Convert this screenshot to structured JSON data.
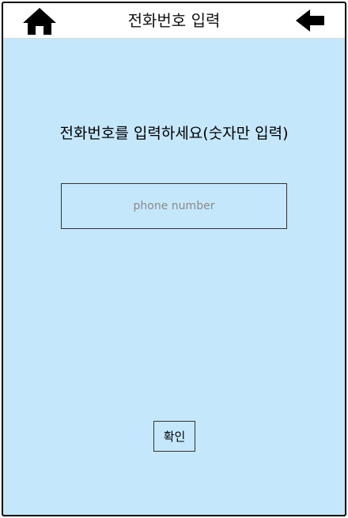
{
  "header": {
    "title": "전화번호 입력",
    "home_icon": "home-icon",
    "back_icon": "back-arrow-icon"
  },
  "main": {
    "prompt": "전화번호를 입력하세요(숫자만 입력)",
    "phone_input": {
      "placeholder": "phone number",
      "value": ""
    },
    "confirm_label": "확인"
  },
  "colors": {
    "background": "#c5e7fb",
    "header_background": "#ffffff",
    "border": "#000000"
  }
}
